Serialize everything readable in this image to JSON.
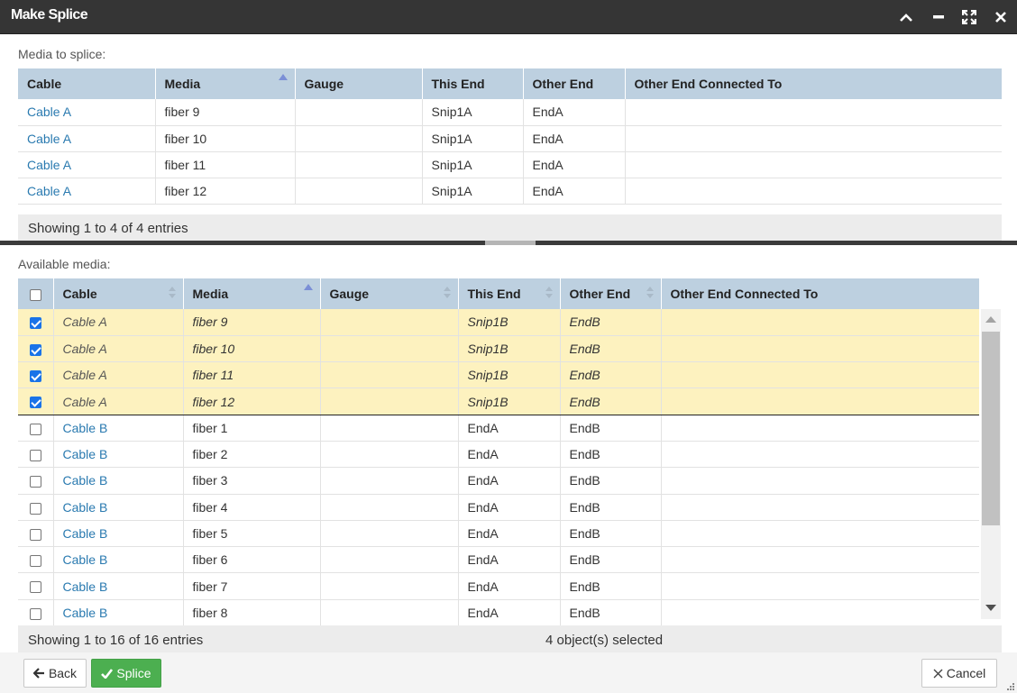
{
  "dialog": {
    "title": "Make Splice"
  },
  "media_to_splice": {
    "label": "Media to splice:",
    "columns": [
      "Cable",
      "Media",
      "Gauge",
      "This End",
      "Other End",
      "Other End Connected To"
    ],
    "rows": [
      [
        "Cable A",
        "fiber 9",
        "",
        "Snip1A",
        "EndA",
        ""
      ],
      [
        "Cable A",
        "fiber 10",
        "",
        "Snip1A",
        "EndA",
        ""
      ],
      [
        "Cable A",
        "fiber 11",
        "",
        "Snip1A",
        "EndA",
        ""
      ],
      [
        "Cable A",
        "fiber 12",
        "",
        "Snip1A",
        "EndA",
        ""
      ]
    ],
    "info": "Showing 1 to 4 of 4 entries"
  },
  "available_media": {
    "label": "Available media:",
    "columns": [
      "Cable",
      "Media",
      "Gauge",
      "This End",
      "Other End",
      "Other End Connected To"
    ],
    "rows": [
      {
        "checked": true,
        "cells": [
          "Cable A",
          "fiber 9",
          "",
          "Snip1B",
          "EndB",
          ""
        ]
      },
      {
        "checked": true,
        "cells": [
          "Cable A",
          "fiber 10",
          "",
          "Snip1B",
          "EndB",
          ""
        ]
      },
      {
        "checked": true,
        "cells": [
          "Cable A",
          "fiber 11",
          "",
          "Snip1B",
          "EndB",
          ""
        ]
      },
      {
        "checked": true,
        "cells": [
          "Cable A",
          "fiber 12",
          "",
          "Snip1B",
          "EndB",
          ""
        ]
      },
      {
        "checked": false,
        "cells": [
          "Cable B",
          "fiber 1",
          "",
          "EndA",
          "EndB",
          ""
        ]
      },
      {
        "checked": false,
        "cells": [
          "Cable B",
          "fiber 2",
          "",
          "EndA",
          "EndB",
          ""
        ]
      },
      {
        "checked": false,
        "cells": [
          "Cable B",
          "fiber 3",
          "",
          "EndA",
          "EndB",
          ""
        ]
      },
      {
        "checked": false,
        "cells": [
          "Cable B",
          "fiber 4",
          "",
          "EndA",
          "EndB",
          ""
        ]
      },
      {
        "checked": false,
        "cells": [
          "Cable B",
          "fiber 5",
          "",
          "EndA",
          "EndB",
          ""
        ]
      },
      {
        "checked": false,
        "cells": [
          "Cable B",
          "fiber 6",
          "",
          "EndA",
          "EndB",
          ""
        ]
      },
      {
        "checked": false,
        "cells": [
          "Cable B",
          "fiber 7",
          "",
          "EndA",
          "EndB",
          ""
        ]
      },
      {
        "checked": false,
        "cells": [
          "Cable B",
          "fiber 8",
          "",
          "EndA",
          "EndB",
          ""
        ]
      }
    ],
    "info": "Showing 1 to 16 of 16 entries",
    "selected_info": "4 object(s) selected"
  },
  "footer": {
    "back_label": "Back",
    "splice_label": "Splice",
    "cancel_label": "Cancel"
  },
  "colors": {
    "titlebar": "#353535",
    "header": "#bdd0e0",
    "selected_row": "#fdf2bf",
    "link": "#2a7ab0",
    "splice_button": "#4caf50"
  }
}
